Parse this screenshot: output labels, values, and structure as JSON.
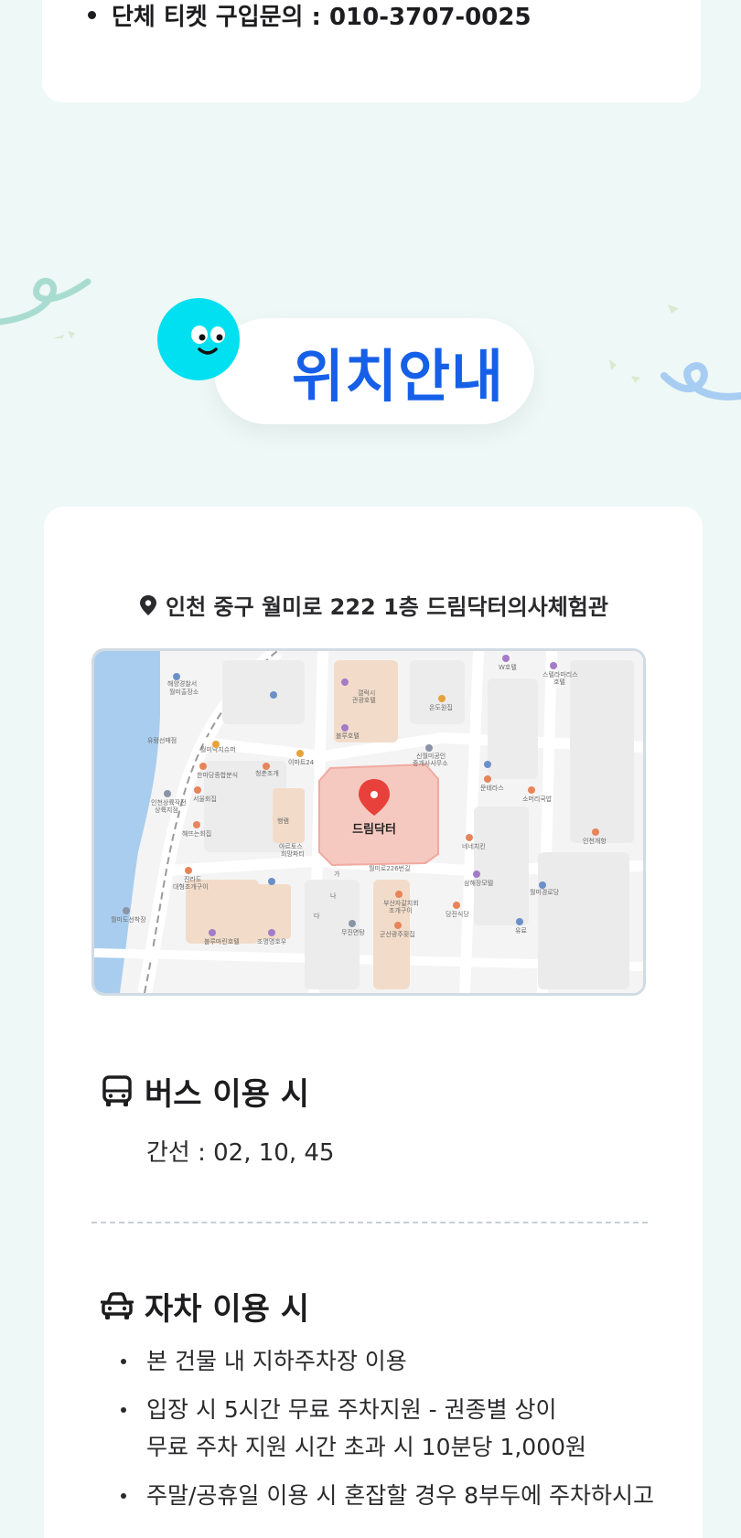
{
  "top_card": {
    "items": [
      "단체 티켓 구입문의 : 010-3707-0025"
    ]
  },
  "section": {
    "title": "위치안내",
    "address": "인천 중구 월미로 222 1층 드림닥터의사체험관"
  },
  "map": {
    "marker_label": "드림닥터",
    "labels": {
      "police": "해양경찰서\n월미출장소",
      "restaurant1": "월미낙지슈퍼",
      "restaurant2": "청춘조개",
      "mart": "이마트24",
      "hotel1": "갤럭시\n관광호텔",
      "hotel2": "블루호텔",
      "realtor": "신월미공인\n중개사사무소",
      "noodle": "유람선매점",
      "snack": "한마당종합분식",
      "seoul": "서울회집",
      "bank": "인천상륙작전\n상륙지점",
      "sunset": "해뜨는회집",
      "jinrado": "진라도\n대형조개구이",
      "bluemarine": "블루마린호텔",
      "pier": "월미도선착장",
      "ncafe": "조명명호우",
      "road": "월미로226번길",
      "parkhotel": "부산자갈치회\n조개구이",
      "gunsan": "군산광주횟집",
      "ondoor": "온도원집",
      "whotel": "W호텔",
      "stella": "스텔라마리스\n호텔",
      "moonterrace": "문테라스",
      "somori": "소머리국밥",
      "wolmi": "월미경로당",
      "incheon": "인천개항",
      "nene": "네네치킨",
      "samhae": "삼해장모텔",
      "dangjin": "당진식당",
      "oil": "유료",
      "jinmyeon": "무진면탕",
      "a": "가",
      "na": "나",
      "da": "다",
      "haenam": "행램",
      "aruto": "아르토스\n희망파티"
    }
  },
  "bus": {
    "title": "버스 이용 시",
    "text": "간선 : 02, 10, 45"
  },
  "car": {
    "title": "자차 이용 시",
    "items": [
      "본 건물 내 지하주차장 이용",
      "입장 시 5시간 무료 주차지원 - 권종별 상이\n무료 주차 지원 시간 초과 시 10분당 1,000원",
      "주말/공휴일 이용 시 혼잡할 경우 8부두에 주차하시고"
    ]
  },
  "colors": {
    "background": "#eef8f6",
    "title_blue": "#1660e8",
    "mascot": "#00e0f0",
    "marker": "#e8413c",
    "map_building_highlight": "#f6c9c0"
  }
}
